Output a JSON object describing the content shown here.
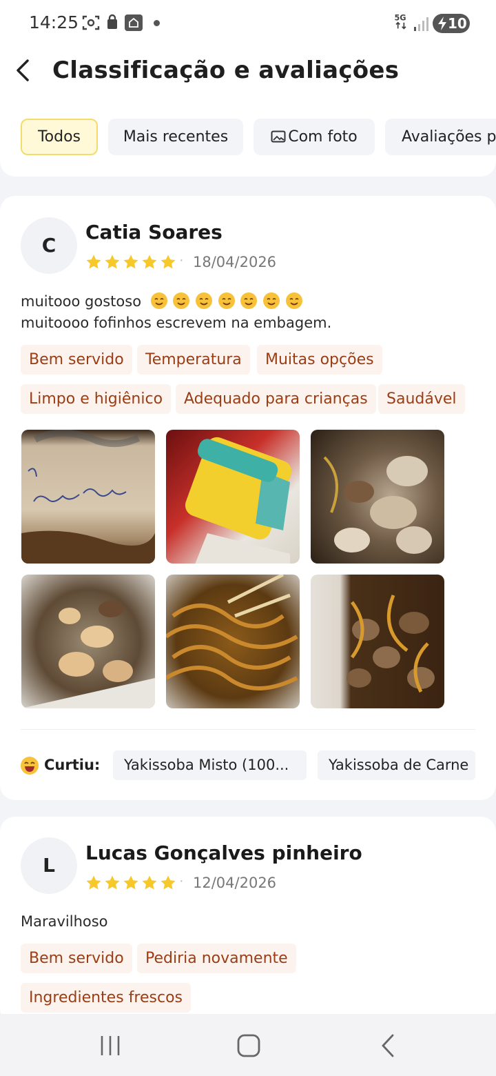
{
  "status": {
    "time": "14:25",
    "network": "5G",
    "battery": "10"
  },
  "header": {
    "title": "Classificação e avaliações"
  },
  "filters": [
    {
      "label": "Todos",
      "active": true
    },
    {
      "label": "Mais recentes",
      "active": false
    },
    {
      "label": "Com foto",
      "active": false
    },
    {
      "label": "Avaliações po",
      "active": false
    }
  ],
  "reviews": [
    {
      "initial": "C",
      "name": "Catia Soares",
      "rating": 5,
      "separator": "·",
      "date": "18/04/2026",
      "text_line1": "muitooo gostoso",
      "text_line2": "muitoooo fofinhos escrevem na embagem.",
      "tags": [
        "Bem servido",
        "Temperatura",
        "Muitas opções",
        "Limpo e higiênico",
        "Adequado para crianças",
        "Saudável"
      ],
      "liked_label": "Curtiu:",
      "liked_items": [
        "Yakissoba Misto (100...",
        "Yakissoba de Carne"
      ]
    },
    {
      "initial": "L",
      "name": "Lucas Gonçalves pinheiro",
      "rating": 5,
      "separator": "·",
      "date": "12/04/2026",
      "text_line1": "Maravilhoso",
      "tags": [
        "Bem servido",
        "Pediria novamente",
        "Ingredientes frescos"
      ]
    }
  ],
  "colors": {
    "accent_star": "#f7c82a",
    "tag_text": "#9a3d14",
    "tag_bg": "#fdf3ee",
    "chip_active_bg": "#fff9d8"
  }
}
